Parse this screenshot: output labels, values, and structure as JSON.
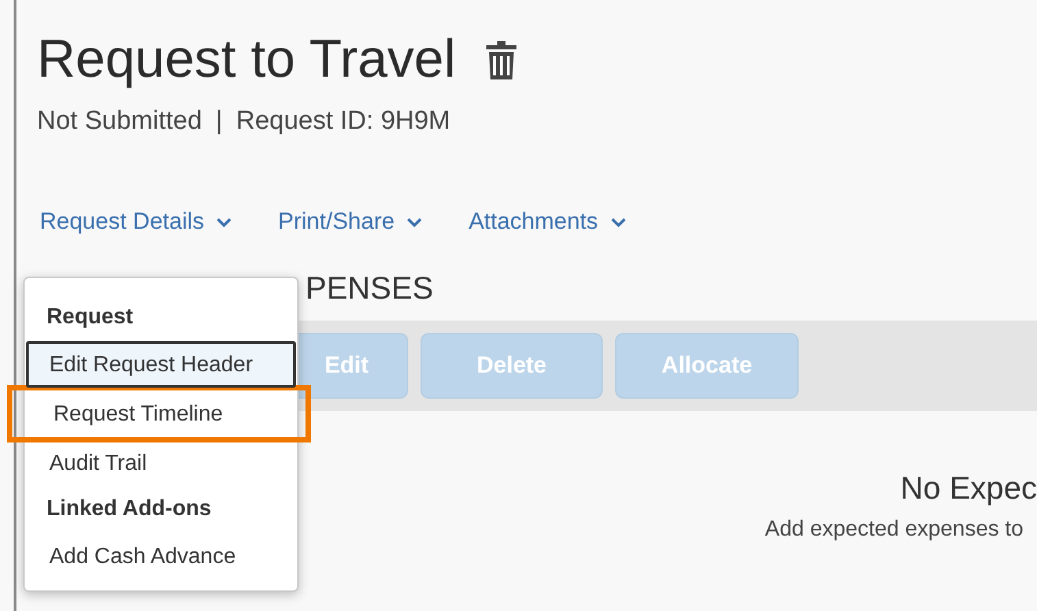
{
  "page": {
    "title": "Request to Travel",
    "status": "Not Submitted",
    "separator": "|",
    "request_id": "Request ID: 9H9M"
  },
  "menu": [
    {
      "label": "Request Details"
    },
    {
      "label": "Print/Share"
    },
    {
      "label": "Attachments"
    }
  ],
  "dropdown": {
    "items": [
      {
        "kind": "header",
        "label": "Request"
      },
      {
        "kind": "item",
        "label": "Edit Request Header",
        "focused": true,
        "highlighted": false
      },
      {
        "kind": "item",
        "label": "Request Timeline",
        "focused": false,
        "highlighted": true
      },
      {
        "kind": "item",
        "label": "Audit Trail",
        "focused": false,
        "highlighted": false
      },
      {
        "kind": "header",
        "label": "Linked Add-ons"
      },
      {
        "kind": "item",
        "label": "Add Cash Advance",
        "focused": false,
        "highlighted": false
      }
    ]
  },
  "section": {
    "heading": "PENSES",
    "buttons": [
      {
        "label": "Edit",
        "disabled": true
      },
      {
        "label": "Delete",
        "disabled": true
      },
      {
        "label": "Allocate",
        "disabled": true
      }
    ],
    "empty_title": "No Expec",
    "empty_text": "Add expected expenses to"
  }
}
